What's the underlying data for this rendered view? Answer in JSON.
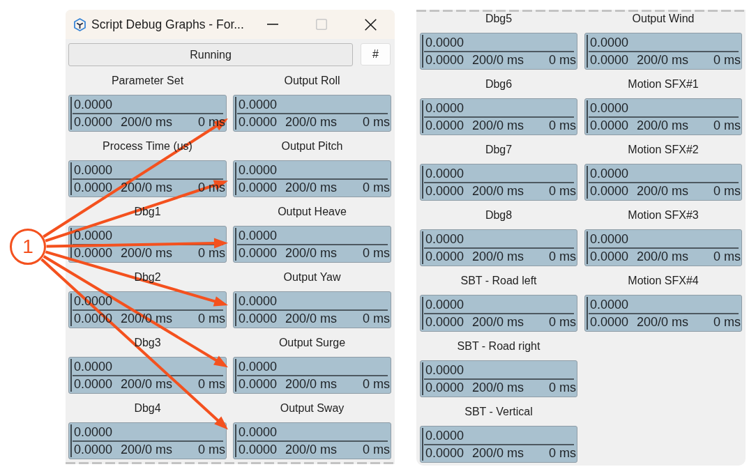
{
  "window": {
    "title": "Script Debug Graphs - For...",
    "controls": [
      {
        "kind": "minimize",
        "disabled": false
      },
      {
        "kind": "maximize",
        "disabled": true
      },
      {
        "kind": "close",
        "disabled": false
      }
    ]
  },
  "toolbar": {
    "run_button": "Running",
    "hash_button": "#"
  },
  "left_panel": {
    "columns": [
      {
        "graphs": [
          {
            "title": "Parameter Set",
            "top_value": "0.0000",
            "bottom_value": "0.0000",
            "timespan": "200/0 ms",
            "time": "0 ms",
            "callout_target": false
          },
          {
            "title": "Process Time (us)",
            "top_value": "0.0000",
            "bottom_value": "0.0000",
            "timespan": "200/0 ms",
            "time": "0 ms",
            "callout_target": false
          },
          {
            "title": "Dbg1",
            "top_value": "0.0000",
            "bottom_value": "0.0000",
            "timespan": "200/0 ms",
            "time": "0 ms",
            "callout_target": false
          },
          {
            "title": "Dbg2",
            "top_value": "0.0000",
            "bottom_value": "0.0000",
            "timespan": "200/0 ms",
            "time": "0 ms",
            "callout_target": false
          },
          {
            "title": "Dbg3",
            "top_value": "0.0000",
            "bottom_value": "0.0000",
            "timespan": "200/0 ms",
            "time": "0 ms",
            "callout_target": false
          },
          {
            "title": "Dbg4",
            "top_value": "0.0000",
            "bottom_value": "0.0000",
            "timespan": "200/0 ms",
            "time": "0 ms",
            "callout_target": false
          }
        ]
      },
      {
        "graphs": [
          {
            "title": "Output Roll",
            "top_value": "0.0000",
            "bottom_value": "0.0000",
            "timespan": "200/0 ms",
            "time": "0 ms",
            "callout_target": true
          },
          {
            "title": "Output Pitch",
            "top_value": "0.0000",
            "bottom_value": "0.0000",
            "timespan": "200/0 ms",
            "time": "0 ms",
            "callout_target": true
          },
          {
            "title": "Output Heave",
            "top_value": "0.0000",
            "bottom_value": "0.0000",
            "timespan": "200/0 ms",
            "time": "0 ms",
            "callout_target": true
          },
          {
            "title": "Output Yaw",
            "top_value": "0.0000",
            "bottom_value": "0.0000",
            "timespan": "200/0 ms",
            "time": "0 ms",
            "callout_target": true
          },
          {
            "title": "Output Surge",
            "top_value": "0.0000",
            "bottom_value": "0.0000",
            "timespan": "200/0 ms",
            "time": "0 ms",
            "callout_target": true
          },
          {
            "title": "Output Sway",
            "top_value": "0.0000",
            "bottom_value": "0.0000",
            "timespan": "200/0 ms",
            "time": "0 ms",
            "callout_target": true
          }
        ]
      }
    ]
  },
  "right_panel": {
    "columns": [
      {
        "graphs": [
          {
            "title": "Dbg5",
            "top_value": "0.0000",
            "bottom_value": "0.0000",
            "timespan": "200/0 ms",
            "time": "0 ms"
          },
          {
            "title": "Dbg6",
            "top_value": "0.0000",
            "bottom_value": "0.0000",
            "timespan": "200/0 ms",
            "time": "0 ms"
          },
          {
            "title": "Dbg7",
            "top_value": "0.0000",
            "bottom_value": "0.0000",
            "timespan": "200/0 ms",
            "time": "0 ms"
          },
          {
            "title": "Dbg8",
            "top_value": "0.0000",
            "bottom_value": "0.0000",
            "timespan": "200/0 ms",
            "time": "0 ms"
          },
          {
            "title": "SBT - Road left",
            "top_value": "0.0000",
            "bottom_value": "0.0000",
            "timespan": "200/0 ms",
            "time": "0 ms"
          },
          {
            "title": "SBT - Road right",
            "top_value": "0.0000",
            "bottom_value": "0.0000",
            "timespan": "200/0 ms",
            "time": "0 ms"
          },
          {
            "title": "SBT - Vertical",
            "top_value": "0.0000",
            "bottom_value": "0.0000",
            "timespan": "200/0 ms",
            "time": "0 ms"
          }
        ]
      },
      {
        "graphs": [
          {
            "title": "Output Wind",
            "top_value": "0.0000",
            "bottom_value": "0.0000",
            "timespan": "200/0 ms",
            "time": "0 ms"
          },
          {
            "title": "Motion SFX#1",
            "top_value": "0.0000",
            "bottom_value": "0.0000",
            "timespan": "200/0 ms",
            "time": "0 ms"
          },
          {
            "title": "Motion SFX#2",
            "top_value": "0.0000",
            "bottom_value": "0.0000",
            "timespan": "200/0 ms",
            "time": "0 ms"
          },
          {
            "title": "Motion SFX#3",
            "top_value": "0.0000",
            "bottom_value": "0.0000",
            "timespan": "200/0 ms",
            "time": "0 ms"
          },
          {
            "title": "Motion SFX#4",
            "top_value": "0.0000",
            "bottom_value": "0.0000",
            "timespan": "200/0 ms",
            "time": "0 ms"
          }
        ]
      }
    ]
  },
  "callout": {
    "number": "1"
  }
}
